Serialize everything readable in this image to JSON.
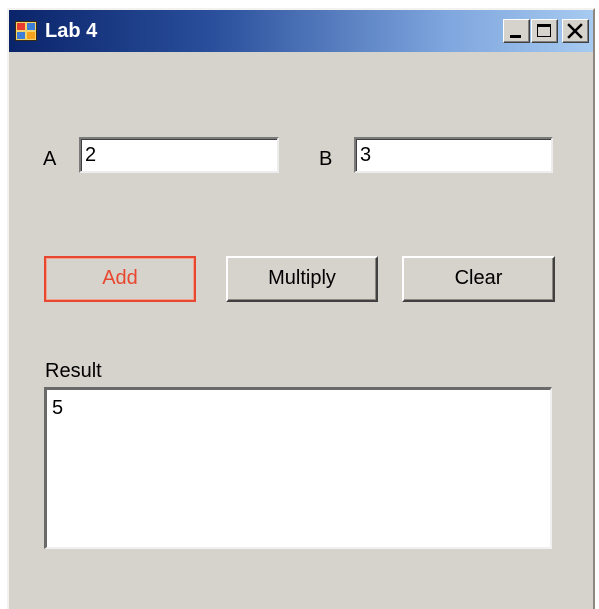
{
  "window": {
    "title": "Lab 4",
    "minimize_label": "minimize",
    "maximize_label": "maximize",
    "close_label": "close"
  },
  "form": {
    "a_label": "A",
    "a_value": "2",
    "b_label": "B",
    "b_value": "3",
    "add_button": "Add",
    "multiply_button": "Multiply",
    "clear_button": "Clear",
    "result_label": "Result",
    "result_value": "5"
  },
  "colors": {
    "form_background": "#d6d2cc",
    "focused_button": "#e8472f",
    "titlebar_start": "#0a246a",
    "titlebar_end": "#a6caf0"
  },
  "icons": {
    "app": "app-window-icon",
    "minimize": "minimize-icon",
    "maximize": "maximize-icon",
    "close": "close-icon"
  }
}
